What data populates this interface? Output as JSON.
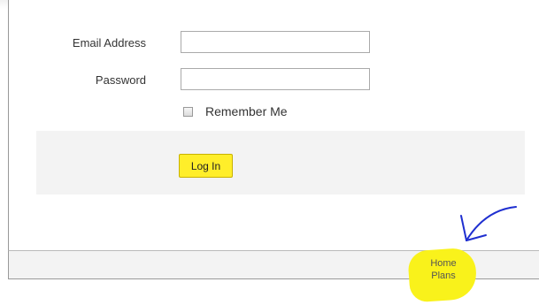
{
  "login_form": {
    "email_label": "Email Address",
    "email_value": "",
    "password_label": "Password",
    "password_value": "",
    "remember_label": "Remember Me",
    "remember_checked": false,
    "login_button": "Log In"
  },
  "footer": {
    "home_plans_line1": "Home",
    "home_plans_line2": "Plans"
  },
  "colors": {
    "button_yellow": "#ffee2a",
    "highlight_yellow": "#f9f21b",
    "annotation_blue": "#1f2fd0"
  }
}
